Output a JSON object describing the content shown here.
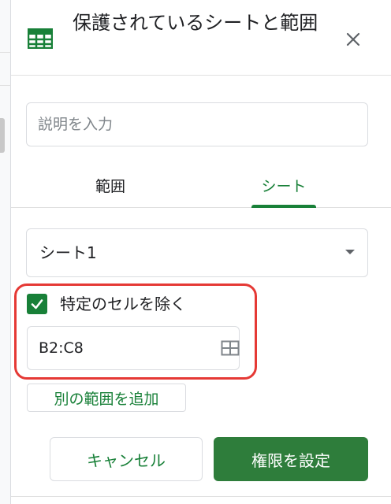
{
  "panel": {
    "title": "保護されているシートと範囲",
    "close_icon": "close-icon",
    "app_icon": "google-sheets-icon",
    "brand_color": "#188038"
  },
  "description": {
    "placeholder": "説明を入力",
    "value": ""
  },
  "tabs": [
    {
      "label": "範囲",
      "selected": false
    },
    {
      "label": "シート",
      "selected": true
    }
  ],
  "sheet_select": {
    "value": "シート1",
    "caret_icon": "dropdown-caret-icon"
  },
  "except_cells": {
    "checked": true,
    "label": "特定のセルを除く",
    "range": "B2:C8",
    "range_icon": "grid-select-icon",
    "highlight_color": "#e53935"
  },
  "add_range_label": "別の範囲を追加",
  "buttons": {
    "cancel": "キャンセル",
    "confirm": "権限を設定",
    "confirm_color": "#2e7d3b"
  }
}
